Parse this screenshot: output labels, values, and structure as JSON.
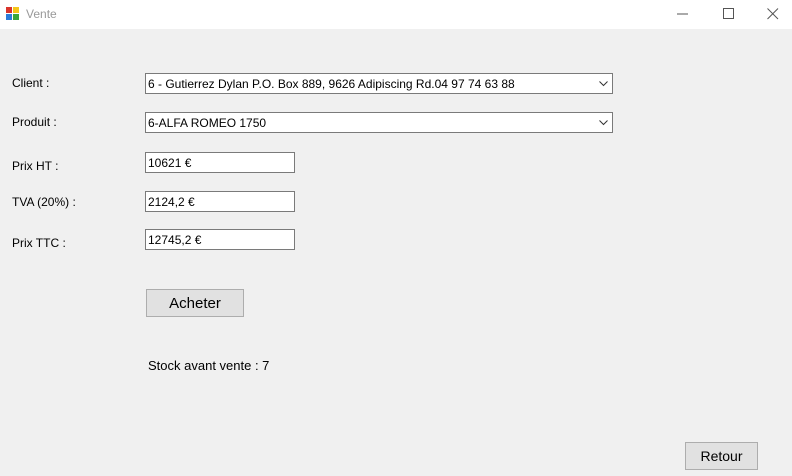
{
  "window": {
    "title": "Vente",
    "app_icon": "winforms-app-icon"
  },
  "form": {
    "client_label": "Client :",
    "client_value": "6 - Gutierrez Dylan P.O. Box 889, 9626 Adipiscing Rd.04 97 74 63 88",
    "produit_label": "Produit :",
    "produit_value": "6-ALFA ROMEO 1750",
    "prix_ht_label": "Prix HT :",
    "prix_ht_value": "10621 €",
    "tva_label": "TVA (20%) :",
    "tva_value": "2124,2 €",
    "prix_ttc_label": "Prix TTC :",
    "prix_ttc_value": "12745,2 €",
    "buy_button": "Acheter",
    "stock_text": "Stock avant vente : 7",
    "back_button": "Retour"
  },
  "colors": {
    "background": "#f0f0f0",
    "button": "#e1e1e1",
    "title_text": "#999999"
  }
}
